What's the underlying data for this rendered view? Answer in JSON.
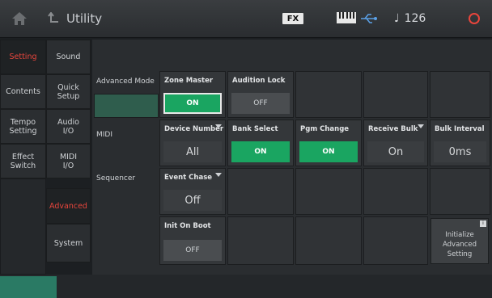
{
  "header": {
    "title": "Utility",
    "fx_badge": "FX",
    "tempo": "126",
    "tempo_glyph": "♩"
  },
  "tabs_col1": [
    {
      "label": "Setting",
      "active": true
    },
    {
      "label": "Contents"
    },
    {
      "label": "Tempo\nSetting"
    },
    {
      "label": "Effect\nSwitch"
    }
  ],
  "tabs_col2": [
    {
      "label": "Sound"
    },
    {
      "label": "Quick\nSetup"
    },
    {
      "label": "Audio\nI/O"
    },
    {
      "label": "MIDI\nI/O"
    },
    {
      "label": "Advanced",
      "active": true
    },
    {
      "label": "System"
    }
  ],
  "sections": {
    "advanced_mode": "Advanced Mode",
    "midi": "MIDI",
    "sequencer": "Sequencer"
  },
  "advanced_mode": {
    "zone_master": {
      "label": "Zone Master",
      "value": "ON"
    },
    "audition_lock": {
      "label": "Audition Lock",
      "value": "OFF"
    }
  },
  "midi": {
    "device_number": {
      "label": "Device Number",
      "value": "All"
    },
    "bank_select": {
      "label": "Bank Select",
      "value": "ON"
    },
    "pgm_change": {
      "label": "Pgm Change",
      "value": "ON"
    },
    "receive_bulk": {
      "label": "Receive Bulk",
      "value": "On"
    },
    "bulk_interval": {
      "label": "Bulk Interval",
      "value": "0ms"
    }
  },
  "sequencer": {
    "event_chase": {
      "label": "Event Chase",
      "value": "Off"
    }
  },
  "init_on_boot": {
    "label": "Init On Boot",
    "value": "OFF"
  },
  "initialize_button": {
    "label": "Initialize\nAdvanced\nSetting"
  },
  "colors": {
    "accent_red": "#e8453c",
    "on_green": "#1aa561"
  }
}
